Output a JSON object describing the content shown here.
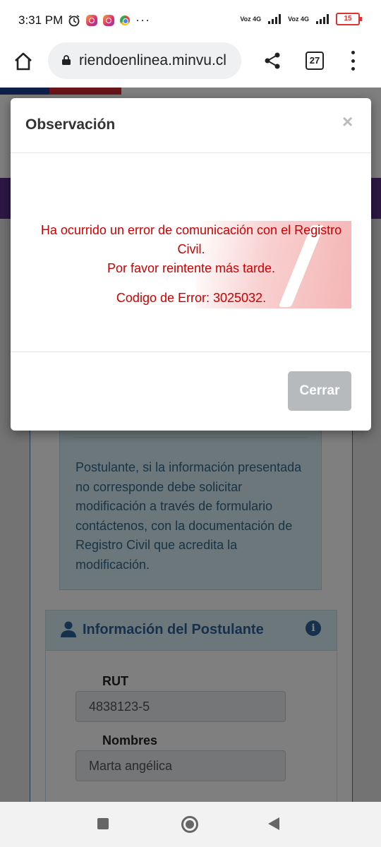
{
  "status_bar": {
    "time": "3:31 PM",
    "network_1": "Voz 4G",
    "network_2": "Voz 4G",
    "battery": "15",
    "icons": [
      "alarm-icon",
      "instagram-icon",
      "instagram-icon",
      "chrome-icon",
      "more-dots-icon",
      "signal-icon",
      "battery-icon"
    ]
  },
  "browser": {
    "url": "riendoenlinea.minvu.cl",
    "tab_count": "27",
    "icons": [
      "home-icon",
      "lock-icon",
      "share-icon",
      "tabs-icon",
      "kebab-menu-icon"
    ]
  },
  "page": {
    "info_text": "Postulante, si la información presentada no corresponde debe solicitar modificación a través de formulario contáctenos, con la documentación de Registro Civil que acredita la modificación.",
    "section_title": "Información del Postulante",
    "rut_label": "RUT",
    "rut_value": "4838123-5",
    "nombres_label": "Nombres",
    "nombres_value": "Marta angélica"
  },
  "modal": {
    "title": "Observación",
    "close_symbol": "×",
    "error_line1": "Ha ocurrido un error de comunicación con el Registro Civil.",
    "error_line2": "Por favor reintente más tarde.",
    "error_line3": "Codigo de Error: 3025032.",
    "close_button": "Cerrar",
    "error_color": "#cc0000"
  },
  "colors": {
    "brand_blue": "#2a6396",
    "info_bg": "#d8eef6",
    "button_disabled": "#b6babd"
  }
}
